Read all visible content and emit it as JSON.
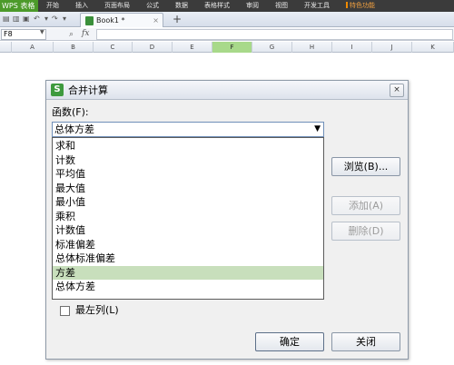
{
  "app": {
    "menu_label": "WPS 表格"
  },
  "ribbon": {
    "tabs": [
      "开始",
      "插入",
      "页面布局",
      "公式",
      "数据",
      "表格样式",
      "审阅",
      "视图",
      "开发工具",
      "特色功能"
    ]
  },
  "document": {
    "tab_name": "Book1 *",
    "close_glyph": "×",
    "new_tab_glyph": "+"
  },
  "formula_bar": {
    "cell_ref": "F8",
    "fx_label": "fx",
    "zoom_glyph": "⌕"
  },
  "columns": {
    "labels": [
      "A",
      "B",
      "C",
      "D",
      "E",
      "F",
      "G",
      "H",
      "I",
      "J",
      "K"
    ],
    "active": "F"
  },
  "dialog": {
    "title": "合并计算",
    "icon_letter": "S",
    "close_glyph": "×",
    "function_label": "函数(F):",
    "function_value": "总体方差",
    "dropdown_arrow": "▼",
    "options": [
      "求和",
      "计数",
      "平均值",
      "最大值",
      "最小值",
      "乘积",
      "计数值",
      "标准偏差",
      "总体标准偏差",
      "方差",
      "总体方差"
    ],
    "highlighted_option": "方差",
    "browse_button": "浏览(B)...",
    "add_button": "添加(A)",
    "delete_button": "删除(D)",
    "leftmost_column_label": "最左列(L)",
    "ok_button": "确定",
    "close_button": "关闭"
  },
  "colors": {
    "accent_green": "#4c9a2a",
    "selection": "#c8dfbc",
    "active_column": "#a8d98a"
  }
}
